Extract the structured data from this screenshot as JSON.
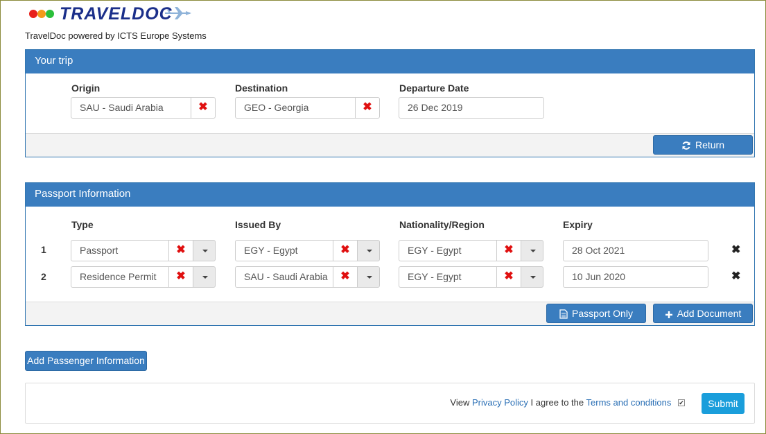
{
  "brand": {
    "logo_text": "TRAVELDOC",
    "powered_by": "TravelDoc powered by ICTS Europe Systems"
  },
  "trip": {
    "title": "Your trip",
    "origin_label": "Origin",
    "origin_value": "SAU - Saudi Arabia",
    "destination_label": "Destination",
    "destination_value": "GEO - Georgia",
    "departure_label": "Departure Date",
    "departure_value": "26 Dec 2019",
    "return_button": "Return"
  },
  "passport": {
    "title": "Passport Information",
    "headers": {
      "type": "Type",
      "issued_by": "Issued By",
      "nationality": "Nationality/Region",
      "expiry": "Expiry"
    },
    "rows": [
      {
        "num": "1",
        "type": "Passport",
        "issued_by": "EGY - Egypt",
        "nationality": "EGY - Egypt",
        "expiry": "28 Oct 2021"
      },
      {
        "num": "2",
        "type": "Residence Permit",
        "issued_by": "SAU - Saudi Arabia",
        "nationality": "EGY - Egypt",
        "expiry": "10 Jun 2020"
      }
    ],
    "passport_only_button": "Passport Only",
    "add_document_button": "Add Document"
  },
  "add_passenger_button": "Add Passenger Information",
  "footer": {
    "view_text": "View",
    "privacy_link": "Privacy Policy",
    "agree_text": "I agree to the",
    "terms_link": "Terms and conditions",
    "checkbox_checked": true,
    "submit_button": "Submit"
  },
  "colors": {
    "panel_header": "#3a7dbf",
    "delete_x": "#e01010",
    "submit": "#1a9edb"
  },
  "icons": [
    "refresh-icon",
    "document-icon",
    "plus-icon",
    "close-icon",
    "caret-down-icon",
    "plane-icon"
  ]
}
